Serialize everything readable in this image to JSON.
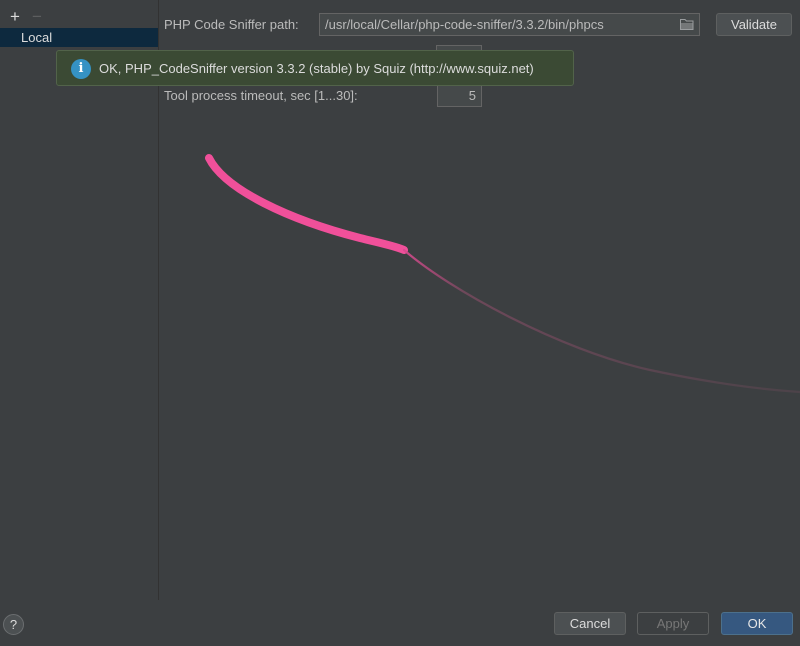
{
  "sidebar": {
    "add_label": "+",
    "remove_label": "−",
    "items": [
      {
        "label": "Local",
        "selected": true
      }
    ]
  },
  "settings": {
    "path_label": "PHP Code Sniffer path:",
    "path_value": "/usr/local/Cellar/php-code-sniffer/3.3.2/bin/phpcs",
    "validate_label": "Validate",
    "timeout_label": "Tool process timeout, sec [1...30]:",
    "timeout_value": "5"
  },
  "tooltip": {
    "icon": "info-icon",
    "text": "OK, PHP_CodeSniffer version 3.3.2 (stable) by Squiz (http://www.squiz.net)"
  },
  "footer": {
    "help_label": "?",
    "cancel_label": "Cancel",
    "apply_label": "Apply",
    "ok_label": "OK"
  },
  "colors": {
    "background": "#3c3f41",
    "selection": "#0d293e",
    "tooltip_bg": "#3b4a34",
    "info": "#3592c4",
    "primary_button": "#365880",
    "cursor_trail": "#f0509a"
  }
}
